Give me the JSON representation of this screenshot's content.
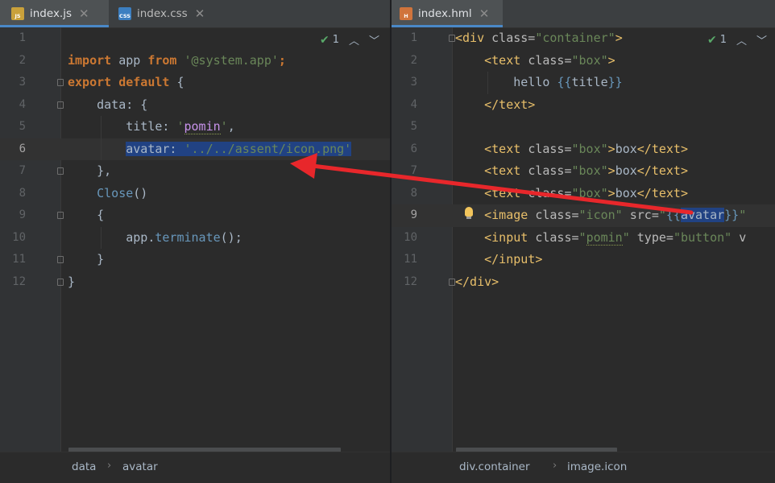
{
  "left_pane": {
    "tabs": [
      {
        "label": "index.js",
        "icon": "JS",
        "active": true
      },
      {
        "label": "index.css",
        "icon": "CSS",
        "active": false
      }
    ],
    "inspection_count": "1",
    "lines": [
      {
        "n": "1"
      },
      {
        "n": "2",
        "tokens": [
          {
            "t": "import",
            "c": "kw"
          },
          {
            "t": " app "
          },
          {
            "t": "from",
            "c": "kw"
          },
          {
            "t": " "
          },
          {
            "t": "'@system.app'",
            "c": "str"
          },
          {
            "t": ";",
            "c": "kw"
          }
        ]
      },
      {
        "n": "3",
        "tokens": [
          {
            "t": "export",
            "c": "kw"
          },
          {
            "t": " "
          },
          {
            "t": "default",
            "c": "kw"
          },
          {
            "t": " {"
          }
        ]
      },
      {
        "n": "4",
        "tokens": [
          {
            "t": "    data",
            "c": ""
          },
          {
            "t": ": {"
          }
        ]
      },
      {
        "n": "5",
        "tokens": [
          {
            "t": "        title",
            "c": ""
          },
          {
            "t": ": "
          },
          {
            "t": "'",
            "c": "str"
          },
          {
            "t": "pomin",
            "c": "pur squig"
          },
          {
            "t": "'",
            "c": "str"
          },
          {
            "t": ","
          }
        ]
      },
      {
        "n": "6",
        "tokens": [
          {
            "t": "        "
          },
          {
            "t": "avatar: ",
            "c": "sel"
          },
          {
            "t": "'../../assent/icon.png'",
            "c": "str sel"
          }
        ]
      },
      {
        "n": "7",
        "tokens": [
          {
            "t": "    },"
          }
        ]
      },
      {
        "n": "8",
        "tokens": [
          {
            "t": "    "
          },
          {
            "t": "Close",
            "c": "mu"
          },
          {
            "t": "()"
          }
        ]
      },
      {
        "n": "9",
        "tokens": [
          {
            "t": "    {"
          }
        ]
      },
      {
        "n": "10",
        "tokens": [
          {
            "t": "        app."
          },
          {
            "t": "terminate",
            "c": "mu"
          },
          {
            "t": "();"
          }
        ]
      },
      {
        "n": "11",
        "tokens": [
          {
            "t": "    }"
          }
        ]
      },
      {
        "n": "12",
        "tokens": [
          {
            "t": "}"
          }
        ]
      }
    ],
    "breadcrumbs": [
      "data",
      "avatar"
    ]
  },
  "right_pane": {
    "tabs": [
      {
        "label": "index.hml",
        "icon": "H",
        "active": true
      }
    ],
    "inspection_count": "1",
    "lines": [
      {
        "n": "1",
        "tokens": [
          {
            "t": "<div ",
            "c": "tag"
          },
          {
            "t": "class=",
            "c": "attr"
          },
          {
            "t": "\"container\"",
            "c": "str"
          },
          {
            "t": ">",
            "c": "tag"
          }
        ]
      },
      {
        "n": "2",
        "tokens": [
          {
            "t": "    "
          },
          {
            "t": "<text ",
            "c": "tag"
          },
          {
            "t": "class=",
            "c": "attr"
          },
          {
            "t": "\"box\"",
            "c": "str"
          },
          {
            "t": ">",
            "c": "tag"
          }
        ]
      },
      {
        "n": "3",
        "tokens": [
          {
            "t": "        hello "
          },
          {
            "t": "{{",
            "c": "mu"
          },
          {
            "t": "title"
          },
          {
            "t": "}}",
            "c": "mu"
          }
        ]
      },
      {
        "n": "4",
        "tokens": [
          {
            "t": "    "
          },
          {
            "t": "</text>",
            "c": "tag"
          }
        ]
      },
      {
        "n": "5"
      },
      {
        "n": "6",
        "tokens": [
          {
            "t": "    "
          },
          {
            "t": "<text ",
            "c": "tag"
          },
          {
            "t": "class=",
            "c": "attr"
          },
          {
            "t": "\"box\"",
            "c": "str"
          },
          {
            "t": ">",
            "c": "tag"
          },
          {
            "t": "box"
          },
          {
            "t": "</text>",
            "c": "tag"
          }
        ]
      },
      {
        "n": "7",
        "tokens": [
          {
            "t": "    "
          },
          {
            "t": "<text ",
            "c": "tag"
          },
          {
            "t": "class=",
            "c": "attr"
          },
          {
            "t": "\"box\"",
            "c": "str"
          },
          {
            "t": ">",
            "c": "tag"
          },
          {
            "t": "box"
          },
          {
            "t": "</text>",
            "c": "tag"
          }
        ]
      },
      {
        "n": "8",
        "tokens": [
          {
            "t": "    "
          },
          {
            "t": "<text ",
            "c": "tag"
          },
          {
            "t": "class=",
            "c": "attr"
          },
          {
            "t": "\"box\"",
            "c": "str"
          },
          {
            "t": ">",
            "c": "tag"
          },
          {
            "t": "box"
          },
          {
            "t": "</text>",
            "c": "tag"
          }
        ]
      },
      {
        "n": "9",
        "tokens": [
          {
            "t": "    "
          },
          {
            "t": "<image ",
            "c": "tag"
          },
          {
            "t": "class=",
            "c": "attr"
          },
          {
            "t": "\"icon\"",
            "c": "str"
          },
          {
            "t": " src=",
            "c": "attr"
          },
          {
            "t": "\"",
            "c": "str"
          },
          {
            "t": "{{",
            "c": "mu"
          },
          {
            "t": "avatar",
            "c": "sel"
          },
          {
            "t": "}}",
            "c": "mu"
          },
          {
            "t": "\"",
            "c": "str"
          }
        ]
      },
      {
        "n": "10",
        "tokens": [
          {
            "t": "    "
          },
          {
            "t": "<input ",
            "c": "tag"
          },
          {
            "t": "class=",
            "c": "attr"
          },
          {
            "t": "\"",
            "c": "str"
          },
          {
            "t": "pomin",
            "c": "str squig"
          },
          {
            "t": "\"",
            "c": "str"
          },
          {
            "t": " type=",
            "c": "attr"
          },
          {
            "t": "\"button\"",
            "c": "str"
          },
          {
            "t": " v",
            "c": "attr"
          }
        ]
      },
      {
        "n": "11",
        "tokens": [
          {
            "t": "    "
          },
          {
            "t": "</input>",
            "c": "tag"
          }
        ]
      },
      {
        "n": "12",
        "tokens": [
          {
            "t": "</div>",
            "c": "tag"
          }
        ]
      }
    ],
    "breadcrumbs": [
      "div.container",
      "image.icon"
    ]
  },
  "colors": {
    "background": "#2b2b2b",
    "keyword": "#cc7832",
    "string": "#6a8759",
    "selection": "#214283",
    "tab_underline": "#4a88c7",
    "arrow": "#e8272b"
  }
}
